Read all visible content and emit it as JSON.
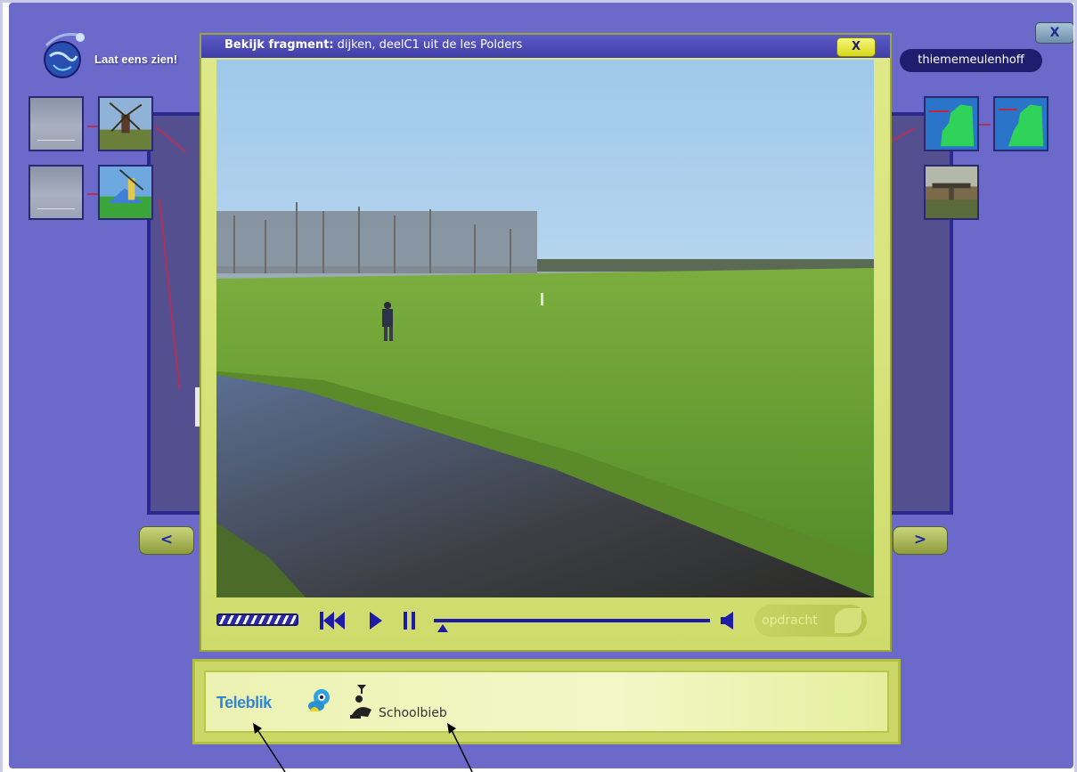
{
  "app": {
    "title": "Laat eens zien!",
    "publisher": "thiememeulenhoff",
    "close_label": "X"
  },
  "navigation": {
    "prev_label": "<",
    "next_label": ">"
  },
  "thumbnails": {
    "left": [
      "power-lines",
      "windmill",
      "power-lines",
      "windmill-diagram"
    ],
    "right": [
      "map-netherlands-1",
      "map-netherlands-2",
      "bridge"
    ]
  },
  "modal": {
    "title_prefix": "Bekijk fragment:",
    "title_text": "dijken, deelC1 uit de les Polders",
    "close_label": "X"
  },
  "player": {
    "task_label": "opdracht",
    "buffer_progress": 1.0,
    "playback_progress": 0.02,
    "icons": [
      "rewind-icon",
      "play-icon",
      "pause-icon",
      "volume-icon"
    ]
  },
  "footer": {
    "teleblik_label": "Teleblik",
    "schoolbieb_label": "Schoolbieb"
  },
  "colors": {
    "background": "#6b6acb",
    "modal": "#d6e27a",
    "title_bar": "#4b4ab5",
    "controls": "#1d1ba8"
  }
}
